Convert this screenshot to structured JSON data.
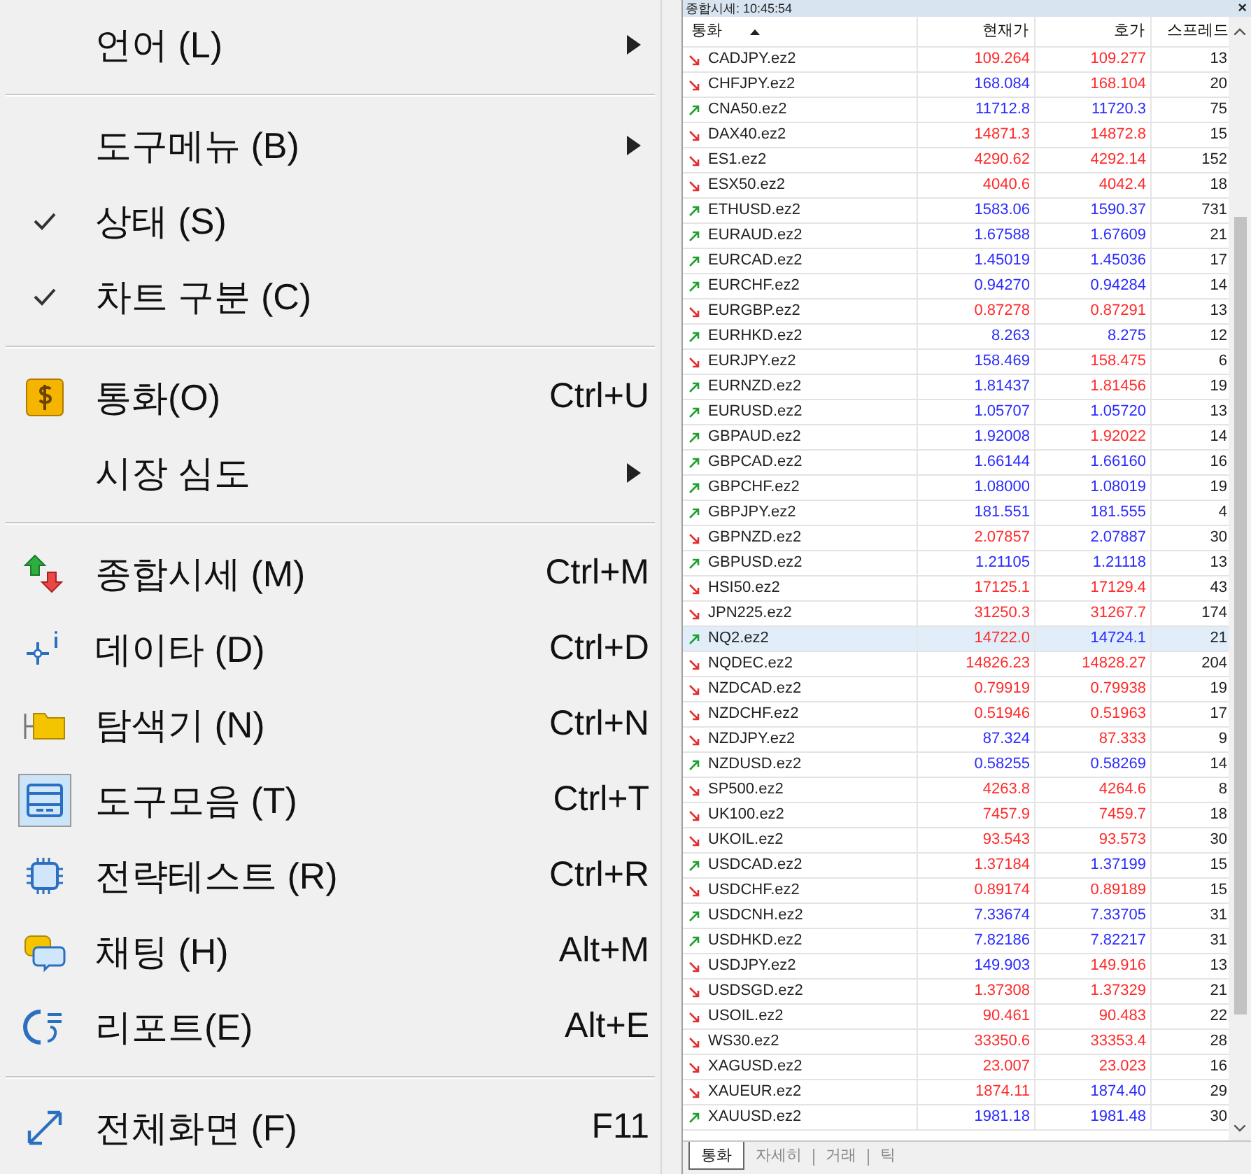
{
  "menu": [
    {
      "kind": "item",
      "label": "언어 (L)",
      "submenu": true,
      "checked": false
    },
    {
      "kind": "separator"
    },
    {
      "kind": "item",
      "label": "도구메뉴 (B)",
      "submenu": true,
      "checked": false
    },
    {
      "kind": "item",
      "label": "상태 (S)",
      "submenu": false,
      "checked": true
    },
    {
      "kind": "item",
      "label": "차트 구분 (C)",
      "submenu": false,
      "checked": true
    },
    {
      "kind": "separator"
    },
    {
      "kind": "icon_item",
      "label": "통화(O)",
      "shortcut": "Ctrl+U",
      "submenu": false,
      "checked": false
    },
    {
      "kind": "item",
      "label": "시장 심도",
      "submenu": true,
      "checked": false
    },
    {
      "kind": "separator"
    },
    {
      "kind": "icon_item",
      "label": "종합시세 (M)",
      "shortcut": "Ctrl+M",
      "submenu": false,
      "checked": false
    },
    {
      "kind": "icon_item",
      "label": "데이타 (D)",
      "shortcut": "Ctrl+D",
      "submenu": false,
      "checked": false
    },
    {
      "kind": "icon_item",
      "label": "탐색기 (N)",
      "shortcut": "Ctrl+N",
      "submenu": false,
      "checked": false
    },
    {
      "kind": "icon_item",
      "label": "도구모음 (T)",
      "shortcut": "Ctrl+T",
      "submenu": false,
      "checked": true
    },
    {
      "kind": "icon_item",
      "label": "전략테스트 (R)",
      "shortcut": "Ctrl+R",
      "submenu": false,
      "checked": false
    },
    {
      "kind": "icon_item",
      "label": "채팅 (H)",
      "shortcut": "Alt+M",
      "submenu": false,
      "checked": false
    },
    {
      "kind": "icon_item",
      "label": "리포트(E)",
      "shortcut": "Alt+E",
      "submenu": false,
      "checked": false
    },
    {
      "kind": "separator"
    },
    {
      "kind": "icon_item",
      "label": "전체화면 (F)",
      "shortcut": "F11",
      "submenu": false,
      "checked": false
    }
  ],
  "market_watch": {
    "title": "종합시세: 10:45:54",
    "close": "×",
    "columns": [
      "통화",
      "현재가",
      "호가",
      "스프레드"
    ],
    "rows": [
      {
        "symbol": "CADJPY.ez2",
        "up": false,
        "bid": "109.264",
        "bid_up": false,
        "ask": "109.277",
        "ask_up": false,
        "spread": "13",
        "selected": false
      },
      {
        "symbol": "CHFJPY.ez2",
        "up": false,
        "bid": "168.084",
        "bid_up": true,
        "ask": "168.104",
        "ask_up": false,
        "spread": "20",
        "selected": false
      },
      {
        "symbol": "CNA50.ez2",
        "up": true,
        "bid": "11712.8",
        "bid_up": true,
        "ask": "11720.3",
        "ask_up": true,
        "spread": "75",
        "selected": false
      },
      {
        "symbol": "DAX40.ez2",
        "up": false,
        "bid": "14871.3",
        "bid_up": false,
        "ask": "14872.8",
        "ask_up": false,
        "spread": "15",
        "selected": false
      },
      {
        "symbol": "ES1.ez2",
        "up": false,
        "bid": "4290.62",
        "bid_up": false,
        "ask": "4292.14",
        "ask_up": false,
        "spread": "152",
        "selected": false
      },
      {
        "symbol": "ESX50.ez2",
        "up": false,
        "bid": "4040.6",
        "bid_up": false,
        "ask": "4042.4",
        "ask_up": false,
        "spread": "18",
        "selected": false
      },
      {
        "symbol": "ETHUSD.ez2",
        "up": true,
        "bid": "1583.06",
        "bid_up": true,
        "ask": "1590.37",
        "ask_up": true,
        "spread": "731",
        "selected": false
      },
      {
        "symbol": "EURAUD.ez2",
        "up": true,
        "bid": "1.67588",
        "bid_up": true,
        "ask": "1.67609",
        "ask_up": true,
        "spread": "21",
        "selected": false
      },
      {
        "symbol": "EURCAD.ez2",
        "up": true,
        "bid": "1.45019",
        "bid_up": true,
        "ask": "1.45036",
        "ask_up": true,
        "spread": "17",
        "selected": false
      },
      {
        "symbol": "EURCHF.ez2",
        "up": true,
        "bid": "0.94270",
        "bid_up": true,
        "ask": "0.94284",
        "ask_up": true,
        "spread": "14",
        "selected": false
      },
      {
        "symbol": "EURGBP.ez2",
        "up": false,
        "bid": "0.87278",
        "bid_up": false,
        "ask": "0.87291",
        "ask_up": false,
        "spread": "13",
        "selected": false
      },
      {
        "symbol": "EURHKD.ez2",
        "up": true,
        "bid": "8.263",
        "bid_up": true,
        "ask": "8.275",
        "ask_up": true,
        "spread": "12",
        "selected": false
      },
      {
        "symbol": "EURJPY.ez2",
        "up": false,
        "bid": "158.469",
        "bid_up": true,
        "ask": "158.475",
        "ask_up": false,
        "spread": "6",
        "selected": false
      },
      {
        "symbol": "EURNZD.ez2",
        "up": true,
        "bid": "1.81437",
        "bid_up": true,
        "ask": "1.81456",
        "ask_up": false,
        "spread": "19",
        "selected": false
      },
      {
        "symbol": "EURUSD.ez2",
        "up": true,
        "bid": "1.05707",
        "bid_up": true,
        "ask": "1.05720",
        "ask_up": true,
        "spread": "13",
        "selected": false
      },
      {
        "symbol": "GBPAUD.ez2",
        "up": true,
        "bid": "1.92008",
        "bid_up": true,
        "ask": "1.92022",
        "ask_up": false,
        "spread": "14",
        "selected": false
      },
      {
        "symbol": "GBPCAD.ez2",
        "up": true,
        "bid": "1.66144",
        "bid_up": true,
        "ask": "1.66160",
        "ask_up": true,
        "spread": "16",
        "selected": false
      },
      {
        "symbol": "GBPCHF.ez2",
        "up": true,
        "bid": "1.08000",
        "bid_up": true,
        "ask": "1.08019",
        "ask_up": true,
        "spread": "19",
        "selected": false
      },
      {
        "symbol": "GBPJPY.ez2",
        "up": true,
        "bid": "181.551",
        "bid_up": true,
        "ask": "181.555",
        "ask_up": true,
        "spread": "4",
        "selected": false
      },
      {
        "symbol": "GBPNZD.ez2",
        "up": false,
        "bid": "2.07857",
        "bid_up": false,
        "ask": "2.07887",
        "ask_up": true,
        "spread": "30",
        "selected": false
      },
      {
        "symbol": "GBPUSD.ez2",
        "up": true,
        "bid": "1.21105",
        "bid_up": true,
        "ask": "1.21118",
        "ask_up": true,
        "spread": "13",
        "selected": false
      },
      {
        "symbol": "HSI50.ez2",
        "up": false,
        "bid": "17125.1",
        "bid_up": false,
        "ask": "17129.4",
        "ask_up": false,
        "spread": "43",
        "selected": false
      },
      {
        "symbol": "JPN225.ez2",
        "up": false,
        "bid": "31250.3",
        "bid_up": false,
        "ask": "31267.7",
        "ask_up": false,
        "spread": "174",
        "selected": false
      },
      {
        "symbol": "NQ2.ez2",
        "up": true,
        "bid": "14722.0",
        "bid_up": false,
        "ask": "14724.1",
        "ask_up": true,
        "spread": "21",
        "selected": true
      },
      {
        "symbol": "NQDEC.ez2",
        "up": false,
        "bid": "14826.23",
        "bid_up": false,
        "ask": "14828.27",
        "ask_up": false,
        "spread": "204",
        "selected": false
      },
      {
        "symbol": "NZDCAD.ez2",
        "up": false,
        "bid": "0.79919",
        "bid_up": false,
        "ask": "0.79938",
        "ask_up": false,
        "spread": "19",
        "selected": false
      },
      {
        "symbol": "NZDCHF.ez2",
        "up": false,
        "bid": "0.51946",
        "bid_up": false,
        "ask": "0.51963",
        "ask_up": false,
        "spread": "17",
        "selected": false
      },
      {
        "symbol": "NZDJPY.ez2",
        "up": false,
        "bid": "87.324",
        "bid_up": true,
        "ask": "87.333",
        "ask_up": false,
        "spread": "9",
        "selected": false
      },
      {
        "symbol": "NZDUSD.ez2",
        "up": true,
        "bid": "0.58255",
        "bid_up": true,
        "ask": "0.58269",
        "ask_up": true,
        "spread": "14",
        "selected": false
      },
      {
        "symbol": "SP500.ez2",
        "up": false,
        "bid": "4263.8",
        "bid_up": false,
        "ask": "4264.6",
        "ask_up": false,
        "spread": "8",
        "selected": false
      },
      {
        "symbol": "UK100.ez2",
        "up": false,
        "bid": "7457.9",
        "bid_up": false,
        "ask": "7459.7",
        "ask_up": false,
        "spread": "18",
        "selected": false
      },
      {
        "symbol": "UKOIL.ez2",
        "up": false,
        "bid": "93.543",
        "bid_up": false,
        "ask": "93.573",
        "ask_up": false,
        "spread": "30",
        "selected": false
      },
      {
        "symbol": "USDCAD.ez2",
        "up": true,
        "bid": "1.37184",
        "bid_up": false,
        "ask": "1.37199",
        "ask_up": true,
        "spread": "15",
        "selected": false
      },
      {
        "symbol": "USDCHF.ez2",
        "up": false,
        "bid": "0.89174",
        "bid_up": false,
        "ask": "0.89189",
        "ask_up": false,
        "spread": "15",
        "selected": false
      },
      {
        "symbol": "USDCNH.ez2",
        "up": true,
        "bid": "7.33674",
        "bid_up": true,
        "ask": "7.33705",
        "ask_up": true,
        "spread": "31",
        "selected": false
      },
      {
        "symbol": "USDHKD.ez2",
        "up": true,
        "bid": "7.82186",
        "bid_up": true,
        "ask": "7.82217",
        "ask_up": true,
        "spread": "31",
        "selected": false
      },
      {
        "symbol": "USDJPY.ez2",
        "up": false,
        "bid": "149.903",
        "bid_up": true,
        "ask": "149.916",
        "ask_up": false,
        "spread": "13",
        "selected": false
      },
      {
        "symbol": "USDSGD.ez2",
        "up": false,
        "bid": "1.37308",
        "bid_up": false,
        "ask": "1.37329",
        "ask_up": false,
        "spread": "21",
        "selected": false
      },
      {
        "symbol": "USOIL.ez2",
        "up": false,
        "bid": "90.461",
        "bid_up": false,
        "ask": "90.483",
        "ask_up": false,
        "spread": "22",
        "selected": false
      },
      {
        "symbol": "WS30.ez2",
        "up": false,
        "bid": "33350.6",
        "bid_up": false,
        "ask": "33353.4",
        "ask_up": false,
        "spread": "28",
        "selected": false
      },
      {
        "symbol": "XAGUSD.ez2",
        "up": false,
        "bid": "23.007",
        "bid_up": false,
        "ask": "23.023",
        "ask_up": false,
        "spread": "16",
        "selected": false
      },
      {
        "symbol": "XAUEUR.ez2",
        "up": false,
        "bid": "1874.11",
        "bid_up": false,
        "ask": "1874.40",
        "ask_up": true,
        "spread": "29",
        "selected": false
      },
      {
        "symbol": "XAUUSD.ez2",
        "up": true,
        "bid": "1981.18",
        "bid_up": true,
        "ask": "1981.48",
        "ask_up": true,
        "spread": "30",
        "selected": false
      }
    ],
    "tabs": [
      {
        "label": "통화",
        "selected": true
      },
      {
        "label": "자세히",
        "selected": false
      },
      {
        "label": "거래",
        "selected": false
      },
      {
        "label": "틱",
        "selected": false
      }
    ]
  }
}
